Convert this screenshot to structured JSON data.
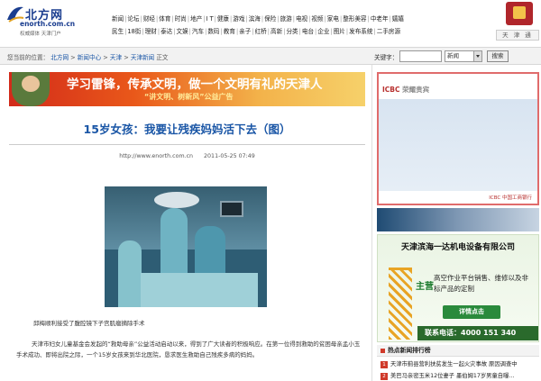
{
  "header": {
    "logo": {
      "brand": "北方网",
      "domain": "enorth.com.cn",
      "slogan": "权威媒体  天津门户"
    },
    "nav_row_1": [
      "新闻",
      "论坛",
      "财经",
      "体育",
      "时尚",
      "地产",
      "I T",
      "健康",
      "游戏",
      "滨海",
      "保险",
      "旅游",
      "电视",
      "视频",
      "家电",
      "整形美容",
      "中老年",
      "嬉嬉"
    ],
    "nav_row_2": [
      "民生",
      "18街",
      "理财",
      "泰达",
      "文娱",
      "汽车",
      "数码",
      "教育",
      "亲子",
      "红桥",
      "高新",
      "分类",
      "电台",
      "企业",
      "图片",
      "发布系统",
      "二手房源"
    ],
    "edition": "天 津 通"
  },
  "location_bar": {
    "prefix": "您当前的位置：",
    "crumbs": [
      "北方网",
      "新闻中心",
      "天津",
      "天津新闻",
      "正文"
    ],
    "search_label": "关键字：",
    "search_value": "",
    "search_scope": "新闻",
    "search_button": "搜索"
  },
  "banner": {
    "headline": "学习雷锋，传承文明，做一个文明有礼的天津人",
    "sub": "“讲文明、树新风”公益广告"
  },
  "article": {
    "title": "15岁女孩：我要让残疾妈妈活下去（图）",
    "url": "http://www.enorth.com.cn",
    "date": "2011-05-25 07:49",
    "photo_caption": "邱梅顺利接受了腹腔镜下子宫肌瘤摘除手术",
    "body": "天津市妇女儿童基金会发起的“救助母亲”公益活动启动以来，得到了广大读者的积极响应。在第一位得到救助的贫困母亲孟小玉手术成功、即将出院之际，一个15岁女孩来到华北医院，恳求医生救助自己残疾多病的妈妈。"
  },
  "sidebar": {
    "icbc_ad": {
      "logo_mark": "ICBC",
      "logo_text": "荣耀贵宾",
      "footer": "ICBC 中国工商银行"
    },
    "machine_ad": {
      "company": "天津滨海一达机电设备有限公司",
      "brand": "主营",
      "desc": "高空作业平台销售、维修以及非标产品的定制",
      "detail_button": "详情点击",
      "phone": "联系电话：4000 151 340"
    },
    "hot_news": {
      "title": "热点新闻排行榜",
      "items": [
        {
          "num": "1",
          "text": "天津市蓟县营利扶贫发生一起火灾事故 原因调查中"
        },
        {
          "num": "2",
          "text": "美巴马亲密玉米12位妻子 墨伯姆17岁男童自曝…"
        }
      ]
    }
  },
  "colors": {
    "link_blue": "#1a56a6",
    "banner_red": "#d22a1a",
    "icbc_red": "#b8312f",
    "ad_green": "#2a8a3c"
  }
}
